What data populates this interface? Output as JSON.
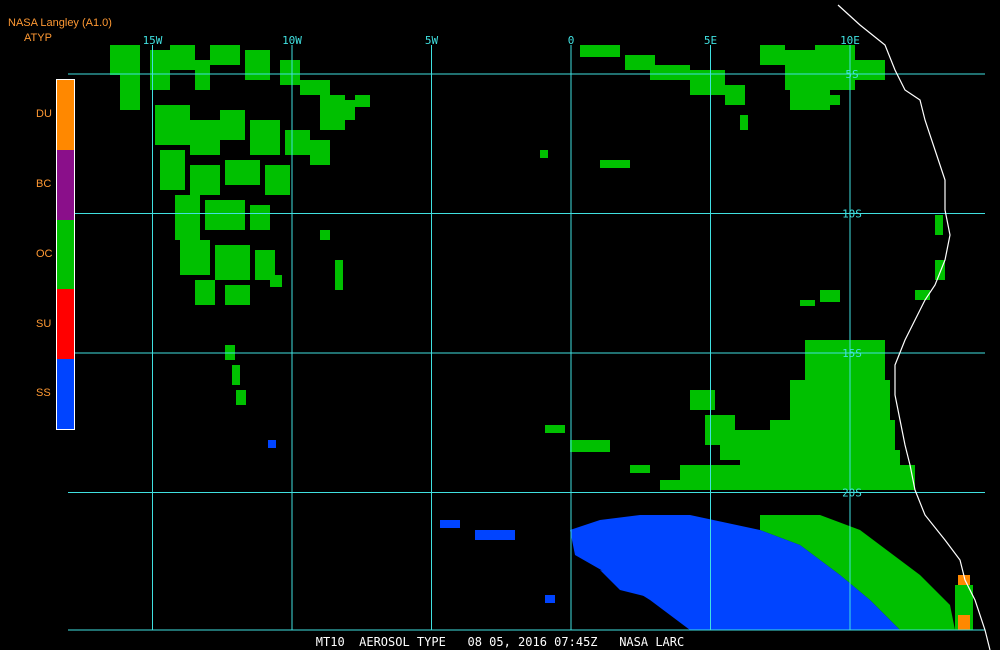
{
  "header": {
    "title": "NASA Langley (A1.0)",
    "product": "ATYP"
  },
  "legend": {
    "items": [
      {
        "code": "DU",
        "color": "#ff8800"
      },
      {
        "code": "BC",
        "color": "#8a0f8a"
      },
      {
        "code": "OC",
        "color": "#00c000"
      },
      {
        "code": "SU",
        "color": "#ff0000"
      },
      {
        "code": "SS",
        "color": "#0044ff"
      }
    ]
  },
  "grid": {
    "longitudes": [
      {
        "label": "15W",
        "lon": -15
      },
      {
        "label": "10W",
        "lon": -10
      },
      {
        "label": "5W",
        "lon": -5
      },
      {
        "label": "0",
        "lon": 0
      },
      {
        "label": "5E",
        "lon": 5
      },
      {
        "label": "10E",
        "lon": 10
      }
    ],
    "latitudes": [
      {
        "label": "5S",
        "lat": -5
      },
      {
        "label": "10S",
        "lat": -10
      },
      {
        "label": "15S",
        "lat": -15
      },
      {
        "label": "20S",
        "lat": -20
      }
    ],
    "line_color": "#40e0e0"
  },
  "colors": {
    "header_text": "#ff9933",
    "legend_text": "#ff9933",
    "footer_text": "#ffffff",
    "grid_label": "#40e0e0",
    "coastline": "#ffffff",
    "background": "#000000"
  },
  "footer": {
    "text": "MT10  AEROSOL TYPE   08 05, 2016 07:45Z   NASA LARC"
  }
}
